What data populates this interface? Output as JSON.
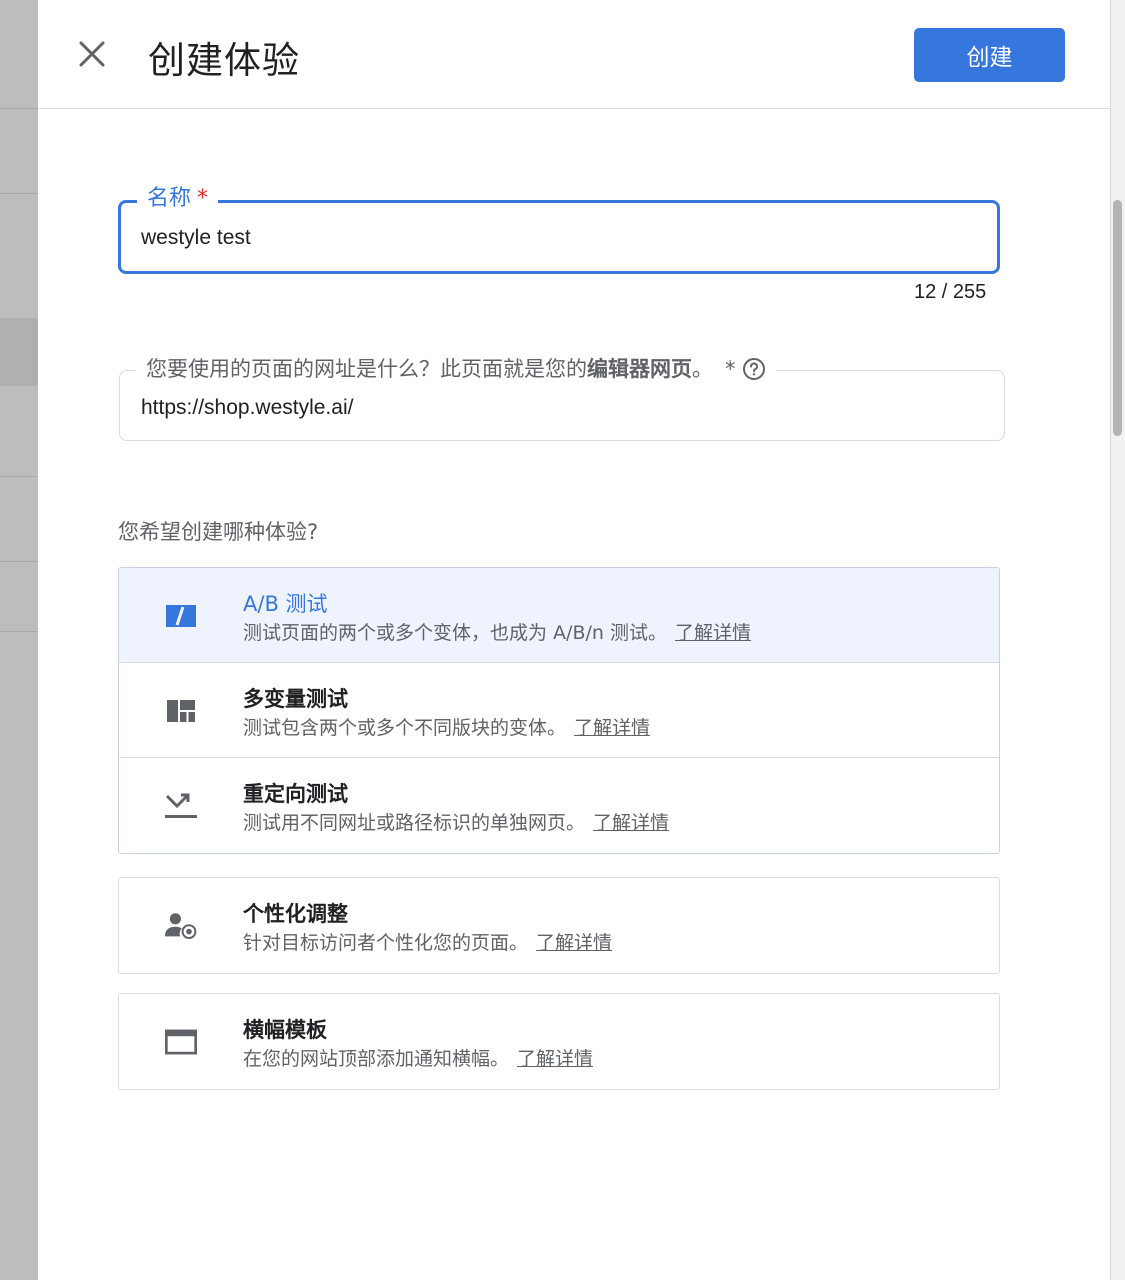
{
  "header": {
    "title": "创建体验",
    "create_label": "创建"
  },
  "name_field": {
    "label": "名称",
    "required_mark": "*",
    "value": "westyle test",
    "counter": "12 / 255"
  },
  "url_field": {
    "label_prefix": "您要使用的页面的网址是什么？此页面就是您的",
    "label_bold": "编辑器网页",
    "label_suffix": "。",
    "required_mark": "*",
    "value": "https://shop.westyle.ai/"
  },
  "question": "您希望创建哪种体验?",
  "learn_more": "了解详情",
  "options": [
    {
      "title": "A/B 测试",
      "desc": "测试页面的两个或多个变体，也成为 A/B/n 测试。",
      "icon": "ab-test-icon",
      "selected": true
    },
    {
      "title": "多变量测试",
      "desc": "测试包含两个或多个不同版块的变体。",
      "icon": "multivariate-icon",
      "selected": false
    },
    {
      "title": "重定向测试",
      "desc": "测试用不同网址或路径标识的单独网页。",
      "icon": "redirect-icon",
      "selected": false
    },
    {
      "title": "个性化调整",
      "desc": "针对目标访问者个性化您的页面。",
      "icon": "personalization-icon",
      "selected": false
    },
    {
      "title": "横幅模板",
      "desc": "在您的网站顶部添加通知横幅。",
      "icon": "banner-icon",
      "selected": false
    }
  ],
  "colors": {
    "accent": "#3677dd",
    "required": "#d93025",
    "selected_bg": "#eef3fd"
  }
}
